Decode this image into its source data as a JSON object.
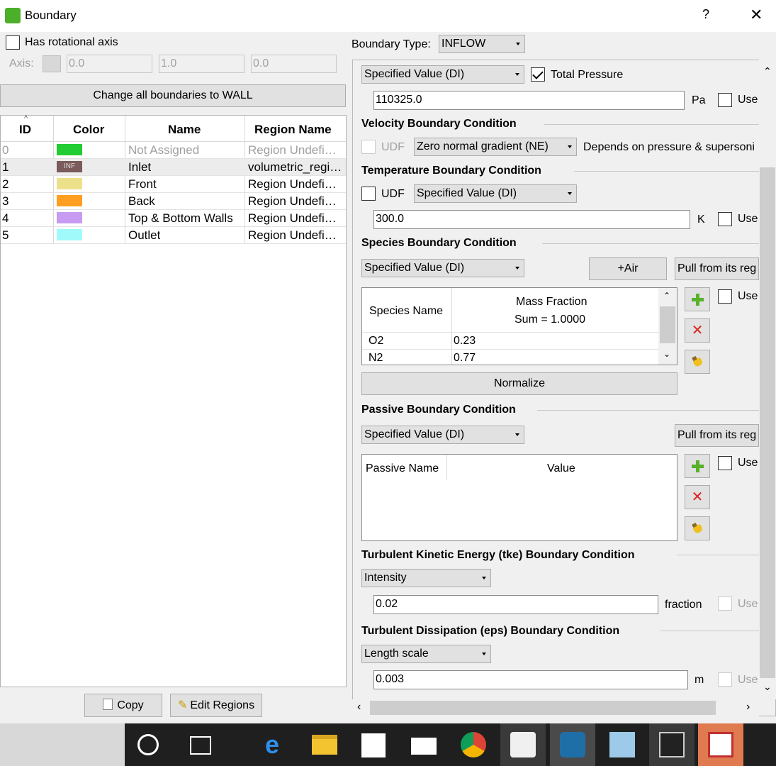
{
  "window": {
    "title": "Boundary",
    "help": "?",
    "close": "✕"
  },
  "left": {
    "rotational_axis": {
      "label": "Has rotational axis",
      "checked": false
    },
    "axis": {
      "label": "Axis:",
      "x": "0.0",
      "y": "1.0",
      "z": "0.0"
    },
    "change_wall_label": "Change all boundaries to WALL",
    "columns": [
      "ID",
      "Color",
      "Name",
      "Region Name"
    ],
    "rows": [
      {
        "id": "0",
        "color": "#22cc33",
        "swatch_text": "",
        "name": "Not Assigned",
        "region": "Region Undefi…",
        "disabled": true
      },
      {
        "id": "1",
        "color": "#7a5a5a",
        "swatch_text": "INF",
        "name": "Inlet",
        "region": "volumetric_regi…",
        "selected": true
      },
      {
        "id": "2",
        "color": "#ede08a",
        "swatch_text": "",
        "name": "Front",
        "region": "Region Undefi…"
      },
      {
        "id": "3",
        "color": "#ff9f22",
        "swatch_text": "",
        "name": "Back",
        "region": "Region Undefi…"
      },
      {
        "id": "4",
        "color": "#c89bf2",
        "swatch_text": "",
        "name": "Top & Bottom Walls",
        "region": "Region Undefi…"
      },
      {
        "id": "5",
        "color": "#a0fafa",
        "swatch_text": "",
        "name": "Outlet",
        "region": "Region Undefi…"
      }
    ],
    "copy_label": "Copy",
    "edit_regions_label": "Edit Regions"
  },
  "right": {
    "boundary_type": {
      "label": "Boundary Type:",
      "value": "INFLOW"
    },
    "pressure": {
      "mode": "Specified Value (DI)",
      "total_pressure_label": "Total Pressure",
      "total_pressure_checked": true,
      "value": "110325.0",
      "unit": "Pa",
      "use_label": "Use"
    },
    "velocity": {
      "title": "Velocity Boundary Condition",
      "udf_label": "UDF",
      "mode": "Zero normal gradient (NE)",
      "note": "Depends on pressure & supersoni"
    },
    "temperature": {
      "title": "Temperature Boundary Condition",
      "udf_label": "UDF",
      "mode": "Specified Value (DI)",
      "value": "300.0",
      "unit": "K",
      "use_label": "Use"
    },
    "species": {
      "title": "Species Boundary Condition",
      "mode": "Specified Value (DI)",
      "air_button": "+Air",
      "pull_button": "Pull from its reg",
      "col_name": "Species Name",
      "col_fraction": "Mass Fraction",
      "sum_label": "Sum = 1.0000",
      "rows": [
        {
          "name": "O2",
          "value": "0.23"
        },
        {
          "name": "N2",
          "value": "0.77"
        }
      ],
      "use_label": "Use",
      "normalize_label": "Normalize"
    },
    "passive": {
      "title": "Passive Boundary Condition",
      "mode": "Specified Value (DI)",
      "pull_button": "Pull from its reg",
      "col_name": "Passive Name",
      "col_value": "Value",
      "use_label": "Use"
    },
    "tke": {
      "title": "Turbulent Kinetic Energy (tke) Boundary Condition",
      "mode": "Intensity",
      "value": "0.02",
      "unit": "fraction",
      "use_label": "Use"
    },
    "eps": {
      "title": "Turbulent Dissipation (eps) Boundary Condition",
      "mode": "Length scale",
      "value": "0.003",
      "unit": "m",
      "use_label": "Use"
    }
  },
  "taskbar": {
    "icons": [
      "cortana-icon",
      "task-view-icon",
      "edge-icon",
      "file-explorer-icon",
      "store-icon",
      "mail-icon",
      "chrome-icon",
      "app-icon",
      "converge-icon",
      "control-panel-icon",
      "terminal-icon",
      "pdf-icon"
    ]
  }
}
